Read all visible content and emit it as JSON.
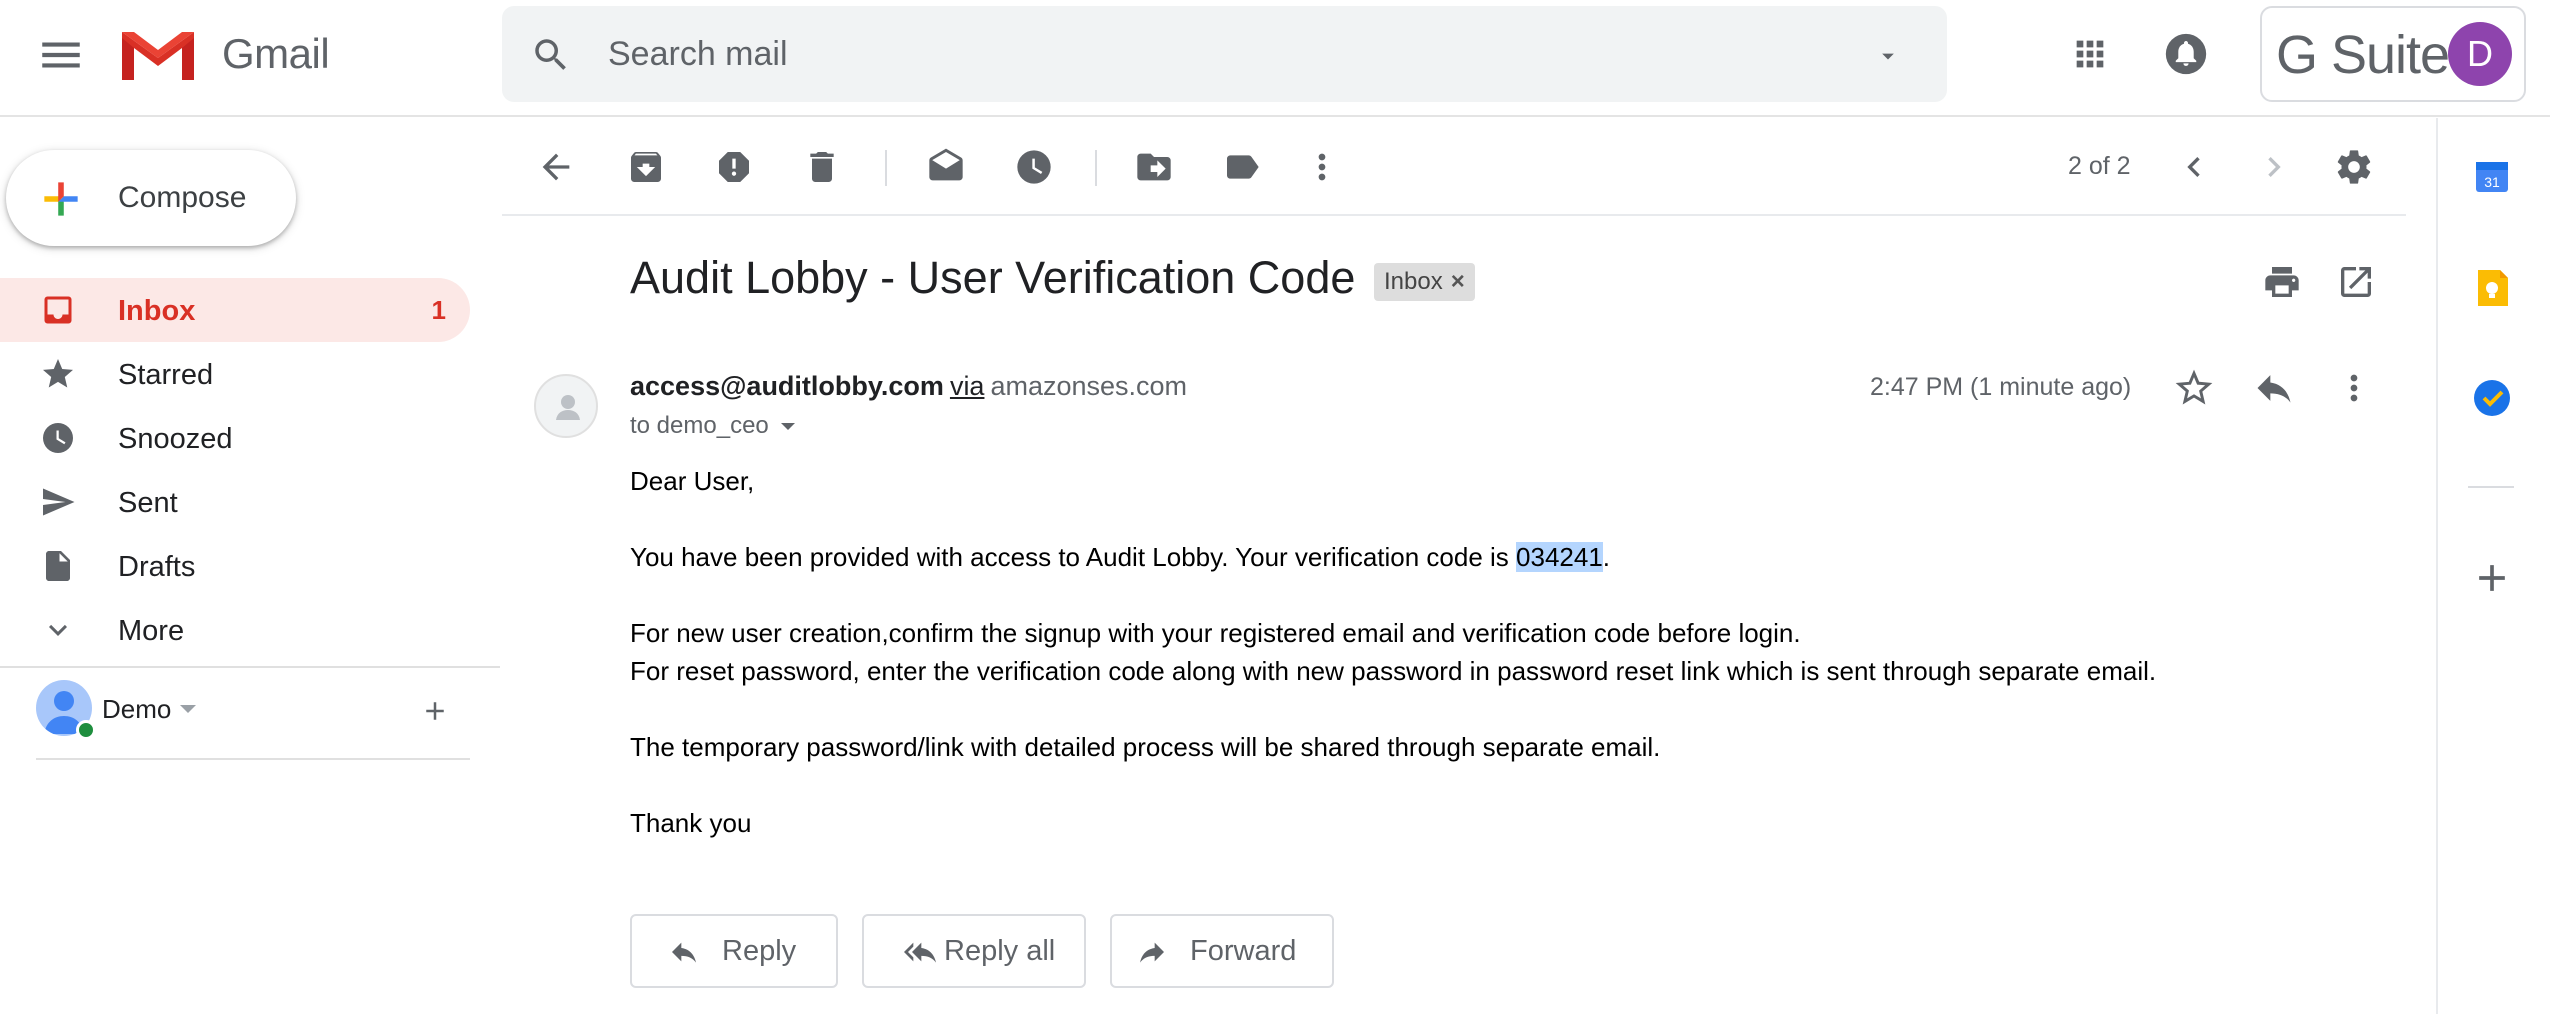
{
  "header": {
    "app_name": "Gmail",
    "search_placeholder": "Search mail",
    "gsuite_label": "G Suite",
    "account_initial": "D",
    "account_color": "#8e44ad"
  },
  "sidebar": {
    "compose_label": "Compose",
    "items": [
      {
        "label": "Inbox",
        "count": "1",
        "icon": "inbox-icon",
        "active": true
      },
      {
        "label": "Starred",
        "icon": "star-icon"
      },
      {
        "label": "Snoozed",
        "icon": "clock-icon"
      },
      {
        "label": "Sent",
        "icon": "send-icon"
      },
      {
        "label": "Drafts",
        "icon": "draft-icon"
      },
      {
        "label": "More",
        "icon": "chevron-down-icon"
      }
    ],
    "hangouts_user": "Demo"
  },
  "toolbar": {
    "pager": "2 of 2"
  },
  "message": {
    "subject": "Audit Lobby - User Verification Code",
    "label_chip": "Inbox",
    "sender_email": "access@auditlobby.com",
    "via": "via",
    "via_domain": "amazonses.com",
    "to": "to demo_ceo",
    "timestamp": "2:47 PM (1 minute ago)",
    "body": {
      "greeting": "Dear User,",
      "line1_before": "You have been provided with access to Audit Lobby. Your verification code is ",
      "code": "034241",
      "line1_after": ".",
      "line2": "For new user creation,confirm the signup with your registered email and verification code before login.",
      "line3": "For reset password, enter the verification code along with new password in password reset link which is sent through separate email.",
      "line4": "The temporary password/link with detailed process will be shared through separate email.",
      "closing": "Thank you"
    },
    "actions": {
      "reply": "Reply",
      "reply_all": "Reply all",
      "forward": "Forward"
    }
  },
  "colors": {
    "accent_red": "#d93025",
    "active_bg": "#fce8e6",
    "highlight": "#b4d5fe"
  }
}
